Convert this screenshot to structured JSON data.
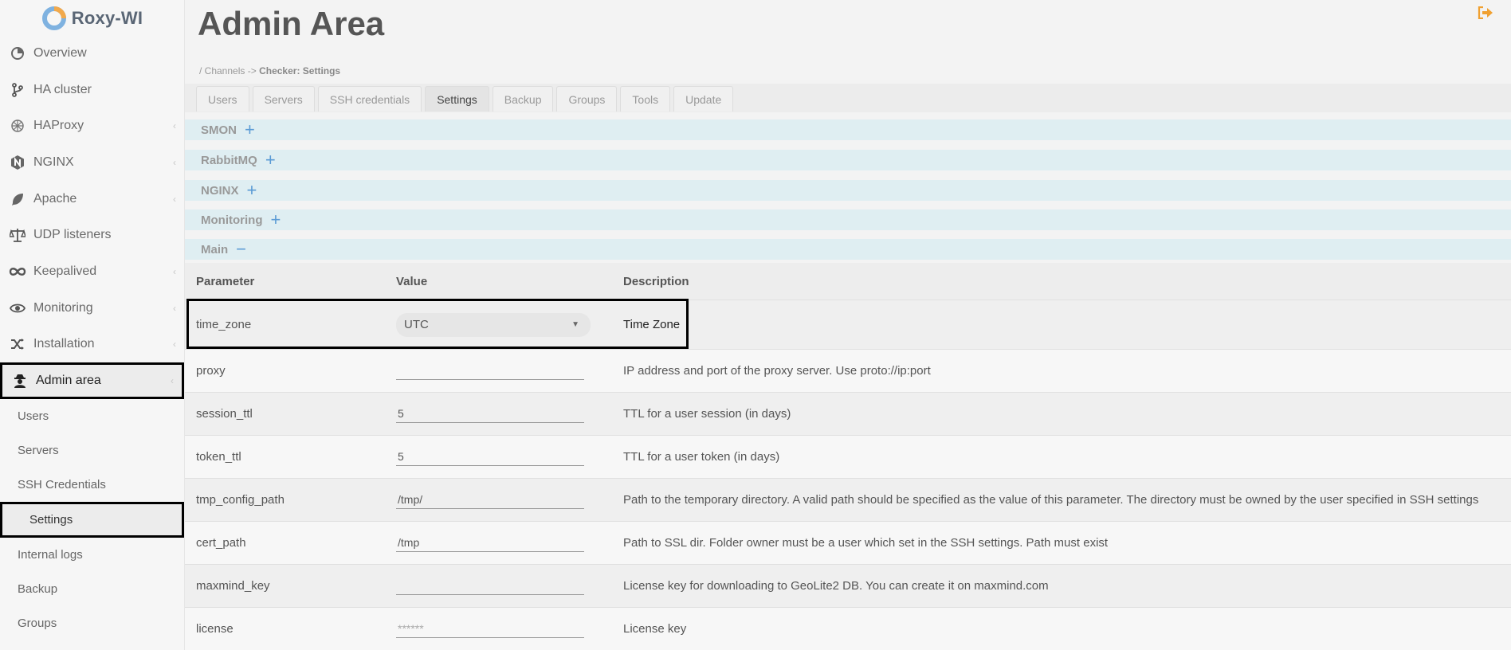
{
  "app": {
    "name": "Roxy-WI"
  },
  "sidebar": {
    "items": [
      {
        "label": "Overview",
        "icon": "overview-icon"
      },
      {
        "label": "HA cluster",
        "icon": "branch-icon"
      },
      {
        "label": "HAProxy",
        "icon": "haproxy-icon"
      },
      {
        "label": "NGINX",
        "icon": "nginx-icon"
      },
      {
        "label": "Apache",
        "icon": "feather-icon"
      },
      {
        "label": "UDP listeners",
        "icon": "balance-icon"
      },
      {
        "label": "Keepalived",
        "icon": "infinity-icon"
      },
      {
        "label": "Monitoring",
        "icon": "eye-icon"
      },
      {
        "label": "Installation",
        "icon": "shuffle-icon"
      },
      {
        "label": "Admin area",
        "icon": "user-secret-icon"
      }
    ],
    "sub_items": [
      {
        "label": "Users"
      },
      {
        "label": "Servers"
      },
      {
        "label": "SSH Credentials"
      },
      {
        "label": "Settings"
      },
      {
        "label": "Internal logs"
      },
      {
        "label": "Backup"
      },
      {
        "label": "Groups"
      }
    ]
  },
  "header": {
    "title": "Admin Area",
    "logout_icon": "sign-out-icon"
  },
  "breadcrumb": {
    "root": "/ Channels",
    "sep": "->",
    "current": "Checker: Settings"
  },
  "tabs": [
    {
      "label": "Users"
    },
    {
      "label": "Servers"
    },
    {
      "label": "SSH credentials"
    },
    {
      "label": "Settings",
      "active": true
    },
    {
      "label": "Backup"
    },
    {
      "label": "Groups"
    },
    {
      "label": "Tools"
    },
    {
      "label": "Update"
    }
  ],
  "sections": [
    {
      "label": "SMON",
      "toggle": "+"
    },
    {
      "label": "RabbitMQ",
      "toggle": "+"
    },
    {
      "label": "NGINX",
      "toggle": "+"
    },
    {
      "label": "Monitoring",
      "toggle": "+"
    },
    {
      "label": "Main",
      "toggle": "−"
    }
  ],
  "table": {
    "headers": {
      "parameter": "Parameter",
      "value": "Value",
      "description": "Description"
    },
    "rows": [
      {
        "param": "time_zone",
        "value": "UTC",
        "type": "select",
        "desc": "Time Zone"
      },
      {
        "param": "proxy",
        "value": "",
        "type": "input",
        "desc": "IP address and port of the proxy server. Use proto://ip:port"
      },
      {
        "param": "session_ttl",
        "value": "5",
        "type": "input",
        "desc": "TTL for a user session (in days)"
      },
      {
        "param": "token_ttl",
        "value": "5",
        "type": "input",
        "desc": "TTL for a user token (in days)"
      },
      {
        "param": "tmp_config_path",
        "value": "/tmp/",
        "type": "input",
        "desc": "Path to the temporary directory. A valid path should be specified as the value of this parameter. The directory must be owned by the user specified in SSH settings"
      },
      {
        "param": "cert_path",
        "value": "/tmp",
        "type": "input",
        "desc": "Path to SSL dir. Folder owner must be a user which set in the SSH settings. Path must exist"
      },
      {
        "param": "maxmind_key",
        "value": "",
        "type": "input",
        "desc": "License key for downloading to GeoLite2 DB. You can create it on maxmind.com"
      },
      {
        "param": "license",
        "value": "******",
        "type": "input",
        "desc": "License key"
      }
    ]
  },
  "colors": {
    "accent": "#5b9bd5",
    "section_bg": "#dfeef2",
    "logout": "#f0a030"
  }
}
